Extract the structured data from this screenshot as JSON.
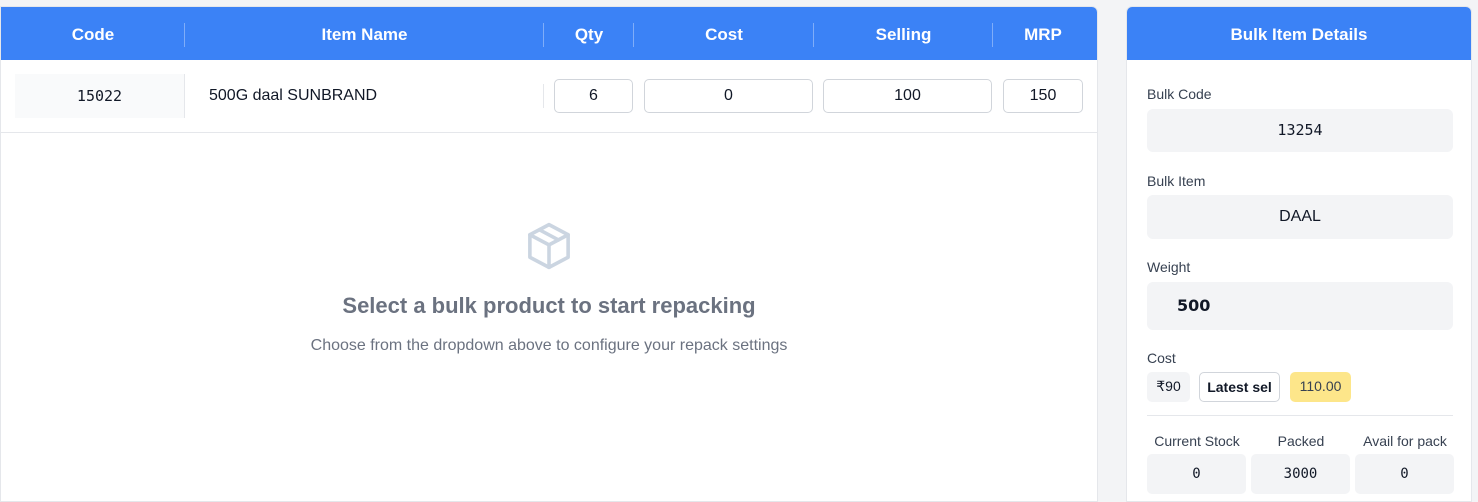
{
  "table": {
    "headers": {
      "code": "Code",
      "item_name": "Item Name",
      "qty": "Qty",
      "cost": "Cost",
      "selling": "Selling",
      "mrp": "MRP"
    },
    "row": {
      "code": "15022",
      "item_name": "500G daal SUNBRAND",
      "qty": "6",
      "cost": "0",
      "selling": "100",
      "mrp": "150"
    }
  },
  "empty_state": {
    "icon": "box-icon",
    "title": "Select a bulk product to start repacking",
    "subtitle": "Choose from the dropdown above to configure your repack settings"
  },
  "bulk_details": {
    "title": "Bulk Item Details",
    "bulk_code_label": "Bulk Code",
    "bulk_code": "13254",
    "bulk_item_label": "Bulk Item",
    "bulk_item": "DAAL",
    "weight_label": "Weight",
    "weight": "500",
    "cost_label": "Cost",
    "cost_value": "₹90",
    "latest_sel_label": "Latest sel",
    "latest_sel_value": "110.00",
    "current_stock_label": "Current Stock",
    "current_stock": "0",
    "packed_label": "Packed",
    "packed": "3000",
    "avail_label": "Avail for pack",
    "avail": "0"
  },
  "colors": {
    "header_blue": "#3b82f6",
    "highlight_yellow": "#fde68a"
  }
}
